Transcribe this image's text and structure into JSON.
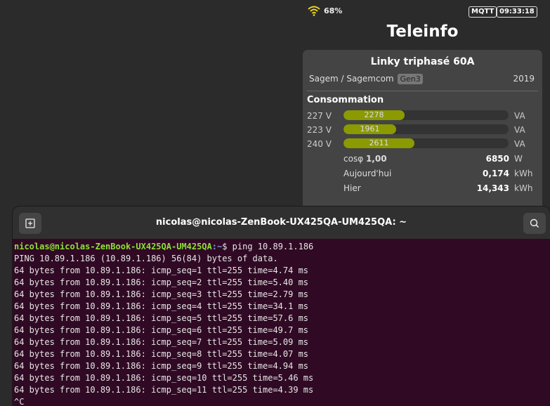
{
  "status": {
    "wifi_percent": "68%",
    "mqtt_label": "MQTT",
    "clock": "09:33:18"
  },
  "app": {
    "title": "Teleinfo"
  },
  "meter": {
    "title": "Linky triphasé 60A",
    "manufacturer": "Sagem / Sagemcom",
    "generation": "Gen3",
    "year": "2019",
    "section_title": "Consommation",
    "phases": [
      {
        "voltage": "227 V",
        "value": "2278",
        "unit": "VA",
        "level": 0.37
      },
      {
        "voltage": "223 V",
        "value": "1961",
        "unit": "VA",
        "level": 0.32
      },
      {
        "voltage": "240 V",
        "value": "2611",
        "unit": "VA",
        "level": 0.43
      }
    ],
    "bar_color": "#8a9a00",
    "cosphi_label": "cosφ",
    "cosphi_value": "1,00",
    "power_value": "6850",
    "power_unit": "W",
    "today_label": "Aujourd'hui",
    "today_value": "0,174",
    "today_unit": "kWh",
    "yesterday_label": "Hier",
    "yesterday_value": "14,343",
    "yesterday_unit": "kWh"
  },
  "terminal": {
    "title": "nicolas@nicolas-ZenBook-UX425QA-UM425QA: ~",
    "prompt_user": "nicolas@nicolas-ZenBook-UX425QA-UM425QA",
    "prompt_path": ":~",
    "command": "$ ping 10.89.1.186",
    "lines": [
      "PING 10.89.1.186 (10.89.1.186) 56(84) bytes of data.",
      "64 bytes from 10.89.1.186: icmp_seq=1 ttl=255 time=4.74 ms",
      "64 bytes from 10.89.1.186: icmp_seq=2 ttl=255 time=5.40 ms",
      "64 bytes from 10.89.1.186: icmp_seq=3 ttl=255 time=2.79 ms",
      "64 bytes from 10.89.1.186: icmp_seq=4 ttl=255 time=34.1 ms",
      "64 bytes from 10.89.1.186: icmp_seq=5 ttl=255 time=57.6 ms",
      "64 bytes from 10.89.1.186: icmp_seq=6 ttl=255 time=49.7 ms",
      "64 bytes from 10.89.1.186: icmp_seq=7 ttl=255 time=5.09 ms",
      "64 bytes from 10.89.1.186: icmp_seq=8 ttl=255 time=4.07 ms",
      "64 bytes from 10.89.1.186: icmp_seq=9 ttl=255 time=4.94 ms",
      "64 bytes from 10.89.1.186: icmp_seq=10 ttl=255 time=5.46 ms",
      "64 bytes from 10.89.1.186: icmp_seq=11 ttl=255 time=4.39 ms",
      "^C"
    ],
    "icons": {
      "left": "new-tab-icon",
      "right": "search-icon"
    }
  }
}
